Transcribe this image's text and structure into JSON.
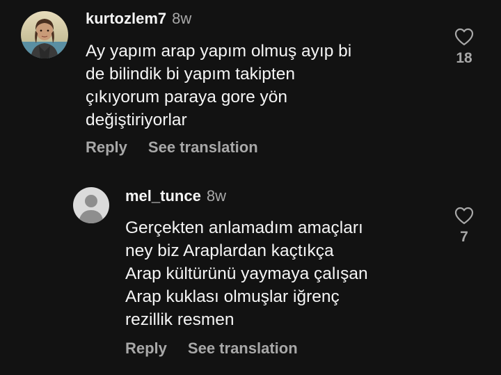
{
  "comments": [
    {
      "username": "kurtozlem7",
      "time": "8w",
      "text": "Ay yapım arap yapım olmuş ayıp bi\nde bilindik bi yapım takipten\nçıkıyorum paraya gore yön\ndeğiştiriyorlar",
      "likes": "18",
      "reply_label": "Reply",
      "translate_label": "See translation"
    },
    {
      "username": "mel_tunce",
      "time": "8w",
      "text": "Gerçekten anlamadım amaçları\nney biz Araplardan kaçtıkça\nArap kültürünü yaymaya çalışan\nArap kuklası olmuşlar iğrenç\nrezillik resmen",
      "likes": "7",
      "reply_label": "Reply",
      "translate_label": "See translation"
    }
  ],
  "icons": {
    "like": "heart-outline-icon",
    "avatar_default": "default-avatar-icon"
  },
  "colors": {
    "background": "#121212",
    "primary_text": "#f5f5f5",
    "secondary_text": "#a8a8a8"
  }
}
